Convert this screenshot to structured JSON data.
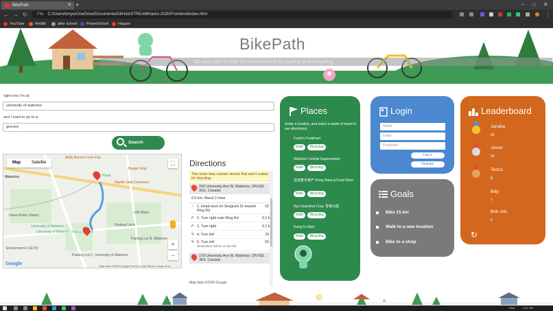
{
  "browser": {
    "tab_title": "BikePath",
    "url_scheme": "File",
    "url": "C:/Users/tonyo/OneDrive/Documents/GitHub/STREAMHacks-2020/Frontend/index.html",
    "bookmarks": [
      {
        "label": "YouTube",
        "color": "#e53935"
      },
      {
        "label": "Reddit",
        "color": "#ff5722"
      },
      {
        "label": "after school",
        "color": "#9e9e9e"
      },
      {
        "label": "PowerSchool",
        "color": "#3f51b5"
      },
      {
        "label": "Hopper",
        "color": "#e53935"
      }
    ]
  },
  "header": {
    "title": "BikePath",
    "tagline": "do your part to help the environment by cycling and recycling"
  },
  "form": {
    "origin_label": "right now I'm at:",
    "origin_value": "university of waterloo",
    "dest_label": "and I want to go to a:",
    "dest_value": "grocery",
    "search_label": "Search"
  },
  "map": {
    "toggle_map": "Map",
    "toggle_satellite": "Satellite",
    "labels": [
      "Molly Bloom's Irish Pub",
      "Burger King",
      "Marble Slab Creamery",
      "Waterloo",
      "Plaza",
      "Dana Porter Library",
      "University of Waterloo",
      "University of Waterloo Visitors Centre",
      "Parking Lot A",
      "Environment 3 (EV3)",
      "UW Place",
      "Parking Lot C, University of Waterloo",
      "Parking Lot N, Waterloo"
    ],
    "google": "Google",
    "footer": "Map data ©2020 Google   Terms of Use   Report a map error"
  },
  "directions": {
    "title": "Directions",
    "warning": "This route may contain streets that aren't suited for bicycling.",
    "start_address": "200 University Ave W, Waterloo, ON N2L 3G1, Canada",
    "summary": "0.5 km. About 2 mins",
    "steps": [
      {
        "n": "1.",
        "text": "Head west on Seagram Dr toward Ring Rd",
        "dist": "52 m"
      },
      {
        "n": "2.",
        "text": "Turn right onto Ring Rd",
        "dist": "0.1 km"
      },
      {
        "n": "3.",
        "text": "Turn right",
        "dist": "0.1 km"
      },
      {
        "n": "4.",
        "text": "Turn left",
        "dist": "29 m"
      },
      {
        "n": "5.",
        "text": "Turn left",
        "dist": "52 m"
      }
    ],
    "step5_note": "Destination will be on the left",
    "end_address": "170 University Ave W, Waterloo, ON N2L 3E9, Canada",
    "map_data": "Map data ©2020 Google"
  },
  "places": {
    "title": "Places",
    "intro": "(enter a location, and select a mode of travel to see directions)",
    "items": [
      {
        "name": "Farah's Foodmart",
        "walk": "Walk",
        "bike": "Bicycling"
      },
      {
        "name": "Waterloo Central Supermarket",
        "walk": "Walk",
        "bike": "Bicycling"
      },
      {
        "name": "亚加麦大特产 Rong Natural Food Store",
        "walk": "Walk",
        "bike": "Bicycling"
      },
      {
        "name": "Nyu Snackhut Corp. 零食の屋",
        "walk": "Walk",
        "bike": "Bicycling"
      },
      {
        "name": "Kung Fu Mart",
        "walk": "Walk",
        "bike": "Bicycling"
      }
    ]
  },
  "login": {
    "title": "Login",
    "name_placeholder": "Name",
    "email_placeholder": "Email",
    "password_placeholder": "Password",
    "login_label": "Log in",
    "register_label": "Register"
  },
  "goals": {
    "title": "Goals",
    "items": [
      "Bike 15 km",
      "Walk to a new location",
      "Bike to a shop"
    ]
  },
  "leaderboard": {
    "title": "Leaderboard",
    "entries": [
      {
        "name": "Janaka",
        "score": "35"
      },
      {
        "name": "Jason",
        "score": "24"
      },
      {
        "name": "Test11",
        "score": "8"
      },
      {
        "name": "Billy",
        "score": "7"
      },
      {
        "name": "Bob Job",
        "score": "5"
      }
    ]
  },
  "taskbar": {
    "lang": "ENG",
    "time": "2:47 PM"
  },
  "colors": {
    "places": "#2d8a4d",
    "login": "#4b88cf",
    "goals": "#7a7a7a",
    "leaderboard": "#d4671e"
  }
}
